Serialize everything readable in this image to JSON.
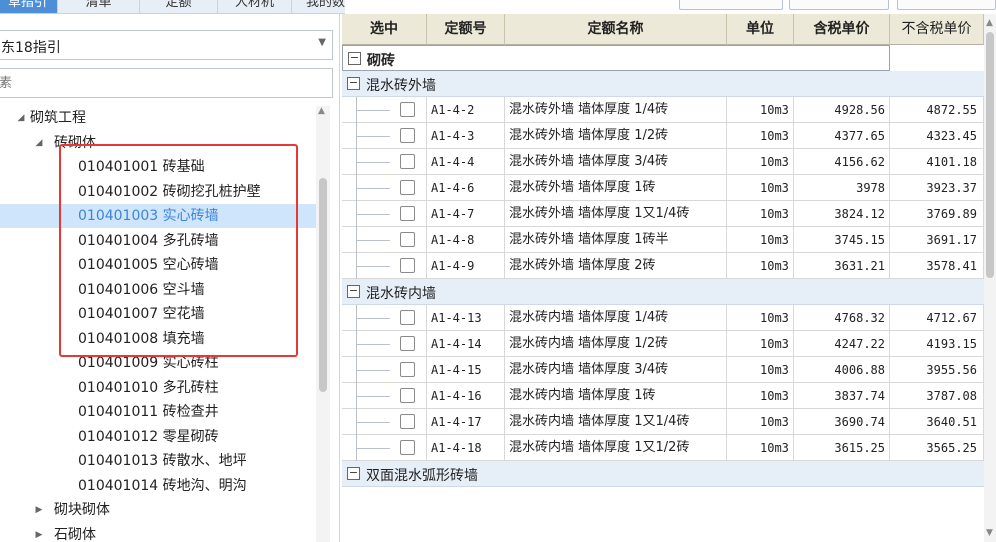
{
  "tabs": [
    {
      "label": "草指引",
      "active": true
    },
    {
      "label": "清单",
      "active": false
    },
    {
      "label": "定额",
      "active": false
    },
    {
      "label": "人材机",
      "active": false
    },
    {
      "label": "我的数据",
      "active": false
    }
  ],
  "left_panel": {
    "guide_select_value": "东18指引",
    "search_placeholder": "素",
    "tree": [
      {
        "label": "砌筑工程",
        "caret": "◢",
        "level": 0
      },
      {
        "label": "砖砌体",
        "caret": "◢",
        "level": 1
      },
      {
        "label": "010401001  砖基础",
        "level": 2
      },
      {
        "label": "010401002  砖砌挖孔桩护壁",
        "level": 2
      },
      {
        "label": "010401003  实心砖墙",
        "level": 2,
        "selected": true
      },
      {
        "label": "010401004  多孔砖墙",
        "level": 2
      },
      {
        "label": "010401005  空心砖墙",
        "level": 2
      },
      {
        "label": "010401006  空斗墙",
        "level": 2
      },
      {
        "label": "010401007  空花墙",
        "level": 2
      },
      {
        "label": "010401008  填充墙",
        "level": 2
      },
      {
        "label": "010401009  实心砖柱",
        "level": 2
      },
      {
        "label": "010401010  多孔砖柱",
        "level": 2
      },
      {
        "label": "010401011  砖检查井",
        "level": 2
      },
      {
        "label": "010401012  零星砌砖",
        "level": 2
      },
      {
        "label": "010401013  砖散水、地坪",
        "level": 2
      },
      {
        "label": "010401014  砖地沟、明沟",
        "level": 2
      },
      {
        "label": "砌块砌体",
        "caret": "▶",
        "level": 1
      },
      {
        "label": "石砌体",
        "caret": "▶",
        "level": 1
      }
    ]
  },
  "grid": {
    "headers": [
      "选中",
      "定额号",
      "定额名称",
      "单位",
      "含税单价",
      "不含税单价"
    ],
    "top_group": "砌砖",
    "groups": [
      {
        "title": "混水砖外墙",
        "rows": [
          {
            "code": "A1-4-2",
            "name": "混水砖外墙 墙体厚度 1/4砖",
            "unit": "10m3",
            "tax": "4928.56",
            "notax": "4872.55"
          },
          {
            "code": "A1-4-3",
            "name": "混水砖外墙 墙体厚度 1/2砖",
            "unit": "10m3",
            "tax": "4377.65",
            "notax": "4323.45"
          },
          {
            "code": "A1-4-4",
            "name": "混水砖外墙 墙体厚度 3/4砖",
            "unit": "10m3",
            "tax": "4156.62",
            "notax": "4101.18"
          },
          {
            "code": "A1-4-6",
            "name": "混水砖外墙 墙体厚度 1砖",
            "unit": "10m3",
            "tax": "3978",
            "notax": "3923.37"
          },
          {
            "code": "A1-4-7",
            "name": "混水砖外墙 墙体厚度 1又1/4砖",
            "unit": "10m3",
            "tax": "3824.12",
            "notax": "3769.89"
          },
          {
            "code": "A1-4-8",
            "name": "混水砖外墙 墙体厚度 1砖半",
            "unit": "10m3",
            "tax": "3745.15",
            "notax": "3691.17"
          },
          {
            "code": "A1-4-9",
            "name": "混水砖外墙 墙体厚度 2砖",
            "unit": "10m3",
            "tax": "3631.21",
            "notax": "3578.41"
          }
        ]
      },
      {
        "title": "混水砖内墙",
        "rows": [
          {
            "code": "A1-4-13",
            "name": "混水砖内墙 墙体厚度 1/4砖",
            "unit": "10m3",
            "tax": "4768.32",
            "notax": "4712.67"
          },
          {
            "code": "A1-4-14",
            "name": "混水砖内墙 墙体厚度 1/2砖",
            "unit": "10m3",
            "tax": "4247.22",
            "notax": "4193.15"
          },
          {
            "code": "A1-4-15",
            "name": "混水砖内墙 墙体厚度 3/4砖",
            "unit": "10m3",
            "tax": "4006.88",
            "notax": "3955.56"
          },
          {
            "code": "A1-4-16",
            "name": "混水砖内墙 墙体厚度 1砖",
            "unit": "10m3",
            "tax": "3837.74",
            "notax": "3787.08"
          },
          {
            "code": "A1-4-17",
            "name": "混水砖内墙 墙体厚度 1又1/4砖",
            "unit": "10m3",
            "tax": "3690.74",
            "notax": "3640.51"
          },
          {
            "code": "A1-4-18",
            "name": "混水砖内墙 墙体厚度 1又1/2砖",
            "unit": "10m3",
            "tax": "3615.25",
            "notax": "3565.25"
          }
        ]
      },
      {
        "title": "双面混水弧形砖墙",
        "rows": []
      }
    ]
  },
  "colors": {
    "accent": "#4c8fd6",
    "selection": "#cfe5fb",
    "highlight_box": "#e53935",
    "header_bg": "#ece9d8",
    "group_bg": "#e6eff8"
  }
}
